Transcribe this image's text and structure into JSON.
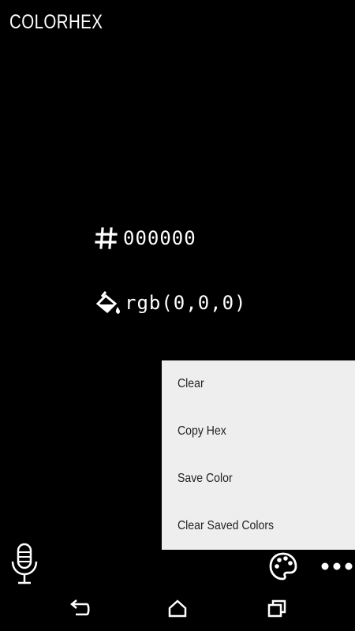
{
  "app": {
    "title": "COLORHEX"
  },
  "color": {
    "hex": "000000",
    "rgb": "rgb(0,0,0)"
  },
  "menu": {
    "items": [
      {
        "label": "Clear"
      },
      {
        "label": "Copy Hex"
      },
      {
        "label": "Save Color"
      },
      {
        "label": "Clear Saved Colors"
      }
    ]
  },
  "icons": {
    "hex": "hash-icon",
    "rgb": "paint-bucket-icon",
    "voice": "microphone-icon",
    "palette": "palette-icon",
    "overflow": "more-vertical-icon",
    "back": "back-icon",
    "home": "home-icon",
    "recents": "recents-icon"
  },
  "colors": {
    "background": "#000000",
    "text": "#ffffff",
    "menu_bg": "#eeeeee",
    "menu_text": "#222222"
  }
}
